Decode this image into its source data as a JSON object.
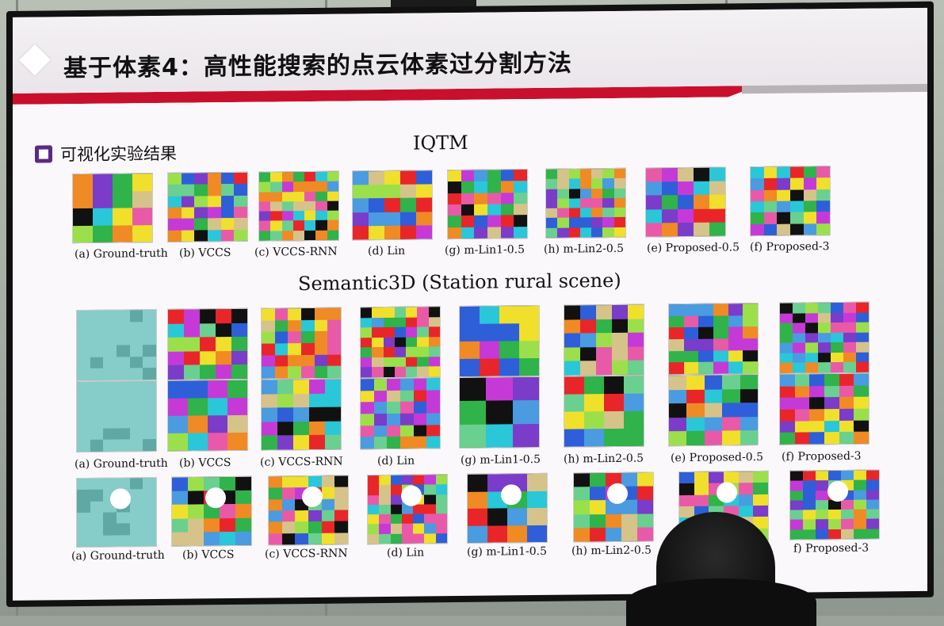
{
  "slide": {
    "title": "基于体素4：高性能搜索的点云体素过分割方法",
    "section": "可视化实验结果"
  },
  "groups": {
    "iqtm": "IQTM",
    "semantic": "Semantic3D  (Station rural scene)"
  },
  "row1_captions": [
    "(a) Ground-truth",
    "(b) VCCS",
    "(c) VCCS-RNN",
    "(d) Lin",
    "(g) m-Lin1-0.5",
    "(h) m-Lin2-0.5",
    "(e) Proposed-0.5",
    "(f) Proposed-3"
  ],
  "row2_captions": [
    "(a) Ground-truth",
    "(b) VCCS",
    "(c) VCCS-RNN",
    "(d) Lin",
    "(g) m-Lin1-0.5",
    "(h) m-Lin2-0.5",
    "(e) Proposed-0.5",
    "(f) Proposed-3"
  ],
  "row3_captions": [
    "(a) Ground-truth",
    "(b) VCCS",
    "(c) VCCS-RNN",
    "(d) Lin",
    "(g) m-Lin1-0.5",
    "(h) m-Lin2-0.5",
    "f) Proposed-3"
  ],
  "colors": {
    "accent_red": "#c8102e",
    "section_purple": "#5b2a83"
  }
}
